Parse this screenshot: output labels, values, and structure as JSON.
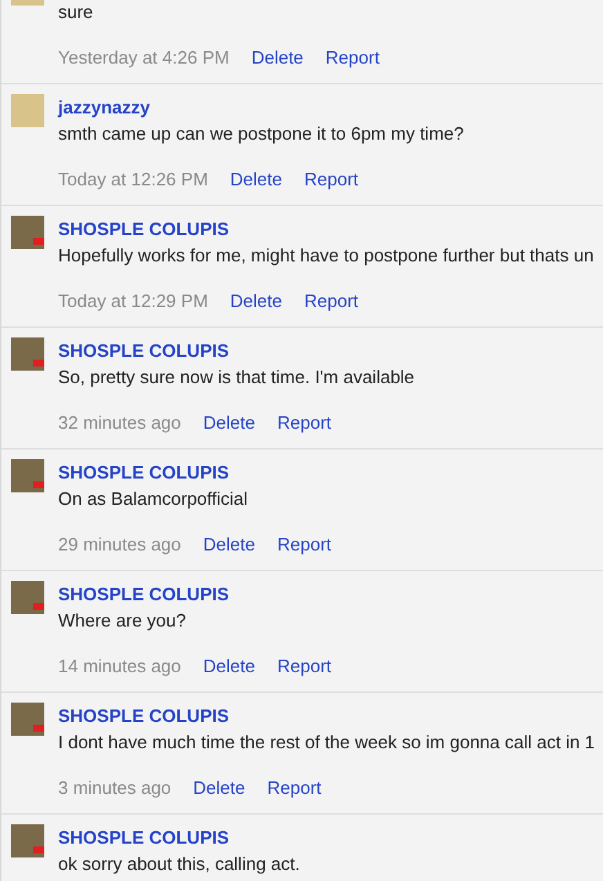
{
  "comments": [
    {
      "kind": "jazzy",
      "text": "sure",
      "time": "Yesterday at 4:26 PM",
      "actions": [
        "Delete",
        "Report"
      ]
    },
    {
      "author": "jazzynazzy",
      "kind": "jazzy",
      "text": "smth came up can we postpone it to 6pm my time?",
      "time": "Today at 12:26 PM",
      "actions": [
        "Delete",
        "Report"
      ]
    },
    {
      "author": "SHOSPLE COLUPIS",
      "kind": "shosple",
      "text": "Hopefully works for me, might have to postpone further but thats un",
      "time": "Today at 12:29 PM",
      "actions": [
        "Delete",
        "Report"
      ]
    },
    {
      "author": "SHOSPLE COLUPIS",
      "kind": "shosple",
      "text": "So, pretty sure now is that time. I'm available",
      "time": "32 minutes ago",
      "actions": [
        "Delete",
        "Report"
      ]
    },
    {
      "author": "SHOSPLE COLUPIS",
      "kind": "shosple",
      "text": "On as Balamcorpofficial",
      "time": "29 minutes ago",
      "actions": [
        "Delete",
        "Report"
      ]
    },
    {
      "author": "SHOSPLE COLUPIS",
      "kind": "shosple",
      "text": "Where are you?",
      "time": "14 minutes ago",
      "actions": [
        "Delete",
        "Report"
      ]
    },
    {
      "author": "SHOSPLE COLUPIS",
      "kind": "shosple",
      "text": "I dont have much time the rest of the week so im gonna call act in 1",
      "time": "3 minutes ago",
      "actions": [
        "Delete",
        "Report"
      ]
    },
    {
      "author": "SHOSPLE COLUPIS",
      "kind": "shosple",
      "text": "ok sorry about this, calling act."
    }
  ]
}
